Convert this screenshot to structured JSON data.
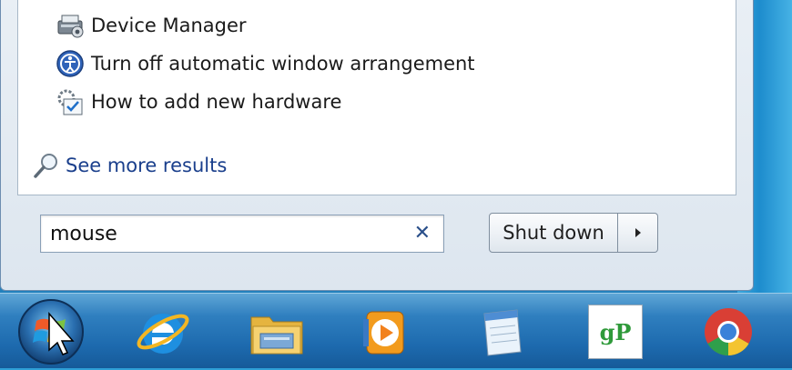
{
  "results": [
    {
      "label": "Device Manager",
      "icon": "device-manager-icon"
    },
    {
      "label": "Turn off automatic window arrangement",
      "icon": "ease-of-access-icon"
    },
    {
      "label": "How to add new hardware",
      "icon": "help-hardware-icon"
    }
  ],
  "see_more": {
    "label": "See more results",
    "icon": "search-icon"
  },
  "search": {
    "value": "mouse",
    "clear_icon": "close-icon"
  },
  "shutdown": {
    "label": "Shut down",
    "arrow_icon": "chevron-right-icon"
  },
  "taskbar": {
    "items": [
      {
        "name": "start-button",
        "icon": "windows-orb-icon"
      },
      {
        "name": "internet-explorer",
        "icon": "internet-explorer-icon"
      },
      {
        "name": "windows-explorer",
        "icon": "folder-icon"
      },
      {
        "name": "media-player",
        "icon": "media-player-icon"
      },
      {
        "name": "notepad",
        "icon": "notepad-icon"
      },
      {
        "name": "groovypost",
        "icon": "gp-app-icon",
        "text": "gP"
      },
      {
        "name": "chrome",
        "icon": "chrome-icon"
      }
    ]
  },
  "colors": {
    "link": "#1a3f8c",
    "taskbar": "#1d6aae",
    "accent": "#2f9fd6"
  }
}
